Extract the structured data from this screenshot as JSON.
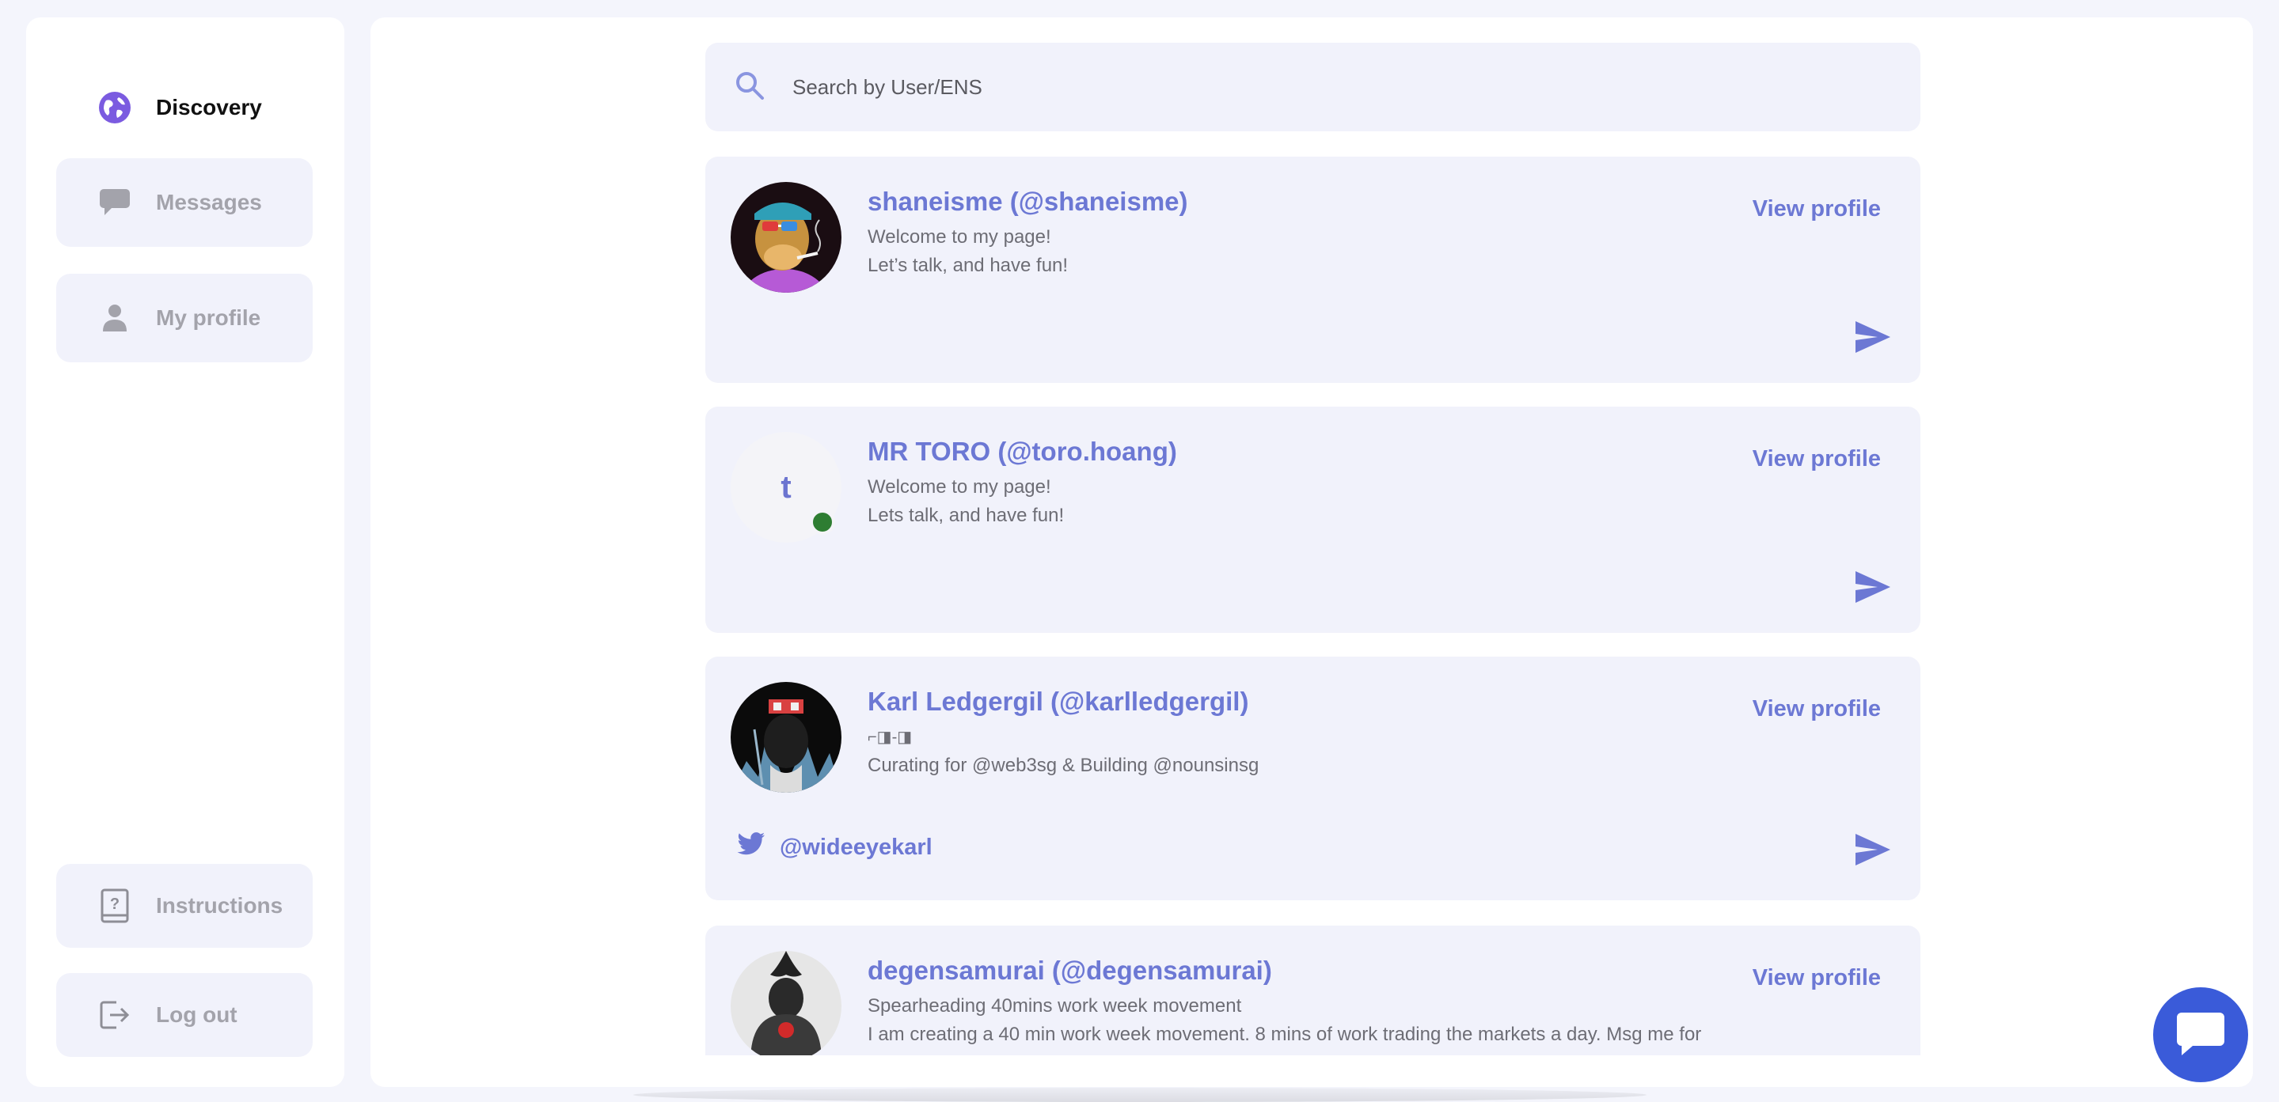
{
  "sidebar": {
    "discovery_label": "Discovery",
    "messages_label": "Messages",
    "profile_label": "My profile",
    "instructions_label": "Instructions",
    "logout_label": "Log out"
  },
  "search": {
    "placeholder": "Search by User/ENS"
  },
  "profiles": [
    {
      "name": "shaneisme (@shaneisme)",
      "bio_line1": "Welcome to my page!",
      "bio_line2": "Let’s talk, and have fun!",
      "view_label": "View profile"
    },
    {
      "name": "MR TORO (@toro.hoang)",
      "avatar_letter": "t",
      "bio_line1": "Welcome to my page!",
      "bio_line2": "Lets talk, and have fun!",
      "view_label": "View profile"
    },
    {
      "name": "Karl Ledgergil (@karlledgergil)",
      "bio_line1": "⌐◨-◨",
      "bio_line2": "Curating for @web3sg & Building @nounsinsg",
      "twitter_handle": "@wideeyekarl",
      "view_label": "View profile"
    },
    {
      "name": "degensamurai (@degensamurai)",
      "bio_line1": "Spearheading 40mins work week movement",
      "bio_line2": "I am creating a 40 min work week movement. 8 mins of work trading the markets a day. Msg me for",
      "view_label": "View profile"
    }
  ],
  "colors": {
    "accent": "#6c78d4",
    "nav_icon_active": "#7b5be0",
    "online": "#2e7d32",
    "fab": "#3a5bd9"
  }
}
